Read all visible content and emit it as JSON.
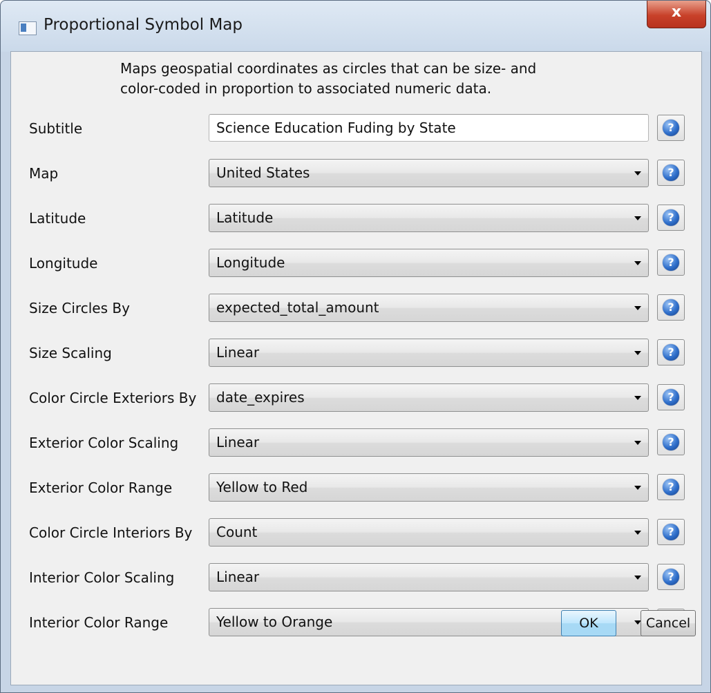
{
  "window": {
    "title": "Proportional Symbol Map",
    "close_glyph": "x"
  },
  "description": {
    "line1": "Maps geospatial coordinates as circles that can be size- and",
    "line2": "color-coded in proportion to associated numeric data."
  },
  "fields": [
    {
      "label": "Subtitle",
      "value": "Science Education Fuding by State",
      "kind": "text"
    },
    {
      "label": "Map",
      "value": "United States",
      "kind": "select"
    },
    {
      "label": "Latitude",
      "value": "Latitude",
      "kind": "select"
    },
    {
      "label": "Longitude",
      "value": "Longitude",
      "kind": "select"
    },
    {
      "label": "Size Circles By",
      "value": "expected_total_amount",
      "kind": "select"
    },
    {
      "label": "Size Scaling",
      "value": "Linear",
      "kind": "select"
    },
    {
      "label": "Color Circle Exteriors By",
      "value": "date_expires",
      "kind": "select"
    },
    {
      "label": "Exterior Color Scaling",
      "value": "Linear",
      "kind": "select"
    },
    {
      "label": "Exterior Color Range",
      "value": "Yellow to Red",
      "kind": "select"
    },
    {
      "label": "Color Circle Interiors By",
      "value": "Count",
      "kind": "select"
    },
    {
      "label": "Interior Color Scaling",
      "value": "Linear",
      "kind": "select"
    },
    {
      "label": "Interior Color Range",
      "value": "Yellow to Orange",
      "kind": "select"
    }
  ],
  "help_glyph": "?",
  "icons": {
    "app": "window-app-icon",
    "close": "close-icon",
    "help": "help-icon",
    "dropdown": "chevron-down-icon"
  },
  "buttons": {
    "ok": "OK",
    "cancel": "Cancel"
  },
  "colors": {
    "titlebar": "#cad9ea",
    "close": "#c8412a",
    "help": "#2f6fcb",
    "ok_button": "#bee6fd",
    "dialog_bg": "#f0f0f0"
  }
}
